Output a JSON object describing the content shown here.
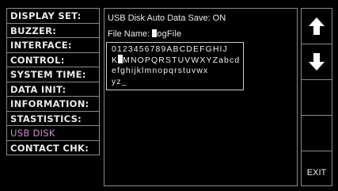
{
  "menu": {
    "items": [
      {
        "label": "DISPLAY SET:"
      },
      {
        "label": "BUZZER:"
      },
      {
        "label": "INTERFACE:"
      },
      {
        "label": "CONTROL:"
      },
      {
        "label": "SYSTEM TIME:"
      },
      {
        "label": "DATA INIT:"
      },
      {
        "label": "INFORMATION:"
      },
      {
        "label": "STASTISTICS:"
      },
      {
        "label": "USB DISK"
      },
      {
        "label": "CONTACT CHK:"
      }
    ],
    "active_index": 8
  },
  "content": {
    "status_text": "USB Disk Auto Data Save: ON",
    "file_name_label": "File Name:",
    "file_name_rest": "ogFile",
    "charset_rows": [
      "0123456789ABCDEFGHIJ",
      "MNOPQRSTUVWXYZabcd",
      "efghijklmnopqrstuvwx",
      "yz_"
    ],
    "charset_row2_prefix": "K"
  },
  "softkeys": {
    "up_icon": "arrow-up-icon",
    "down_icon": "arrow-down-icon",
    "exit_label": "EXIT"
  },
  "colors": {
    "active_menu": "#c98ecb",
    "text": "#ededed",
    "border": "#8a8a8a"
  }
}
